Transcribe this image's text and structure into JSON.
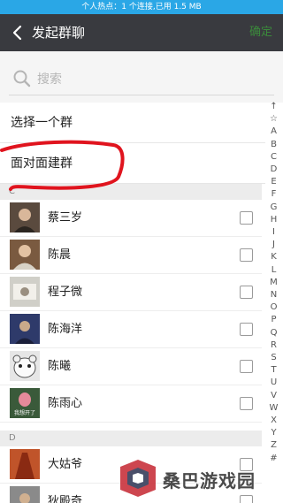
{
  "status_bar": {
    "text": "个人热点：1 个连接,已用 1.5 MB"
  },
  "header": {
    "title": "发起群聊",
    "confirm_label": "确定"
  },
  "search": {
    "placeholder": "搜索"
  },
  "options": [
    {
      "label": "选择一个群"
    },
    {
      "label": "面对面建群"
    }
  ],
  "sections": [
    {
      "letter": "C",
      "contacts": [
        {
          "name": "蔡三岁",
          "avatar_color": "#5a4a3e"
        },
        {
          "name": "陈晨",
          "avatar_color": "#7a5a40"
        },
        {
          "name": "程子微",
          "avatar_color": "#d0cfc8"
        },
        {
          "name": "陈海洋",
          "avatar_color": "#2e3a6a"
        },
        {
          "name": "陈曦",
          "avatar_color": "#e6e6e6"
        },
        {
          "name": "陈雨心",
          "avatar_color": "#3a5a3a",
          "avatar_caption": "我想开了"
        }
      ]
    },
    {
      "letter": "D",
      "contacts": [
        {
          "name": "大姑爷",
          "avatar_color": "#c0542a"
        },
        {
          "name": "狄殿奇",
          "avatar_color": "#8a8a8a"
        }
      ]
    }
  ],
  "alphabet_index": [
    "↑",
    "☆",
    "A",
    "B",
    "C",
    "D",
    "E",
    "F",
    "G",
    "H",
    "I",
    "J",
    "K",
    "L",
    "M",
    "N",
    "O",
    "P",
    "Q",
    "R",
    "S",
    "T",
    "U",
    "V",
    "W",
    "X",
    "Y",
    "Z",
    "#"
  ],
  "watermark": {
    "text": "桑巴游戏园"
  },
  "colors": {
    "status_bar": "#2aa7e6",
    "title_bar": "#393a3f",
    "confirm": "#3b8a3b",
    "scribble": "#e0141e"
  }
}
